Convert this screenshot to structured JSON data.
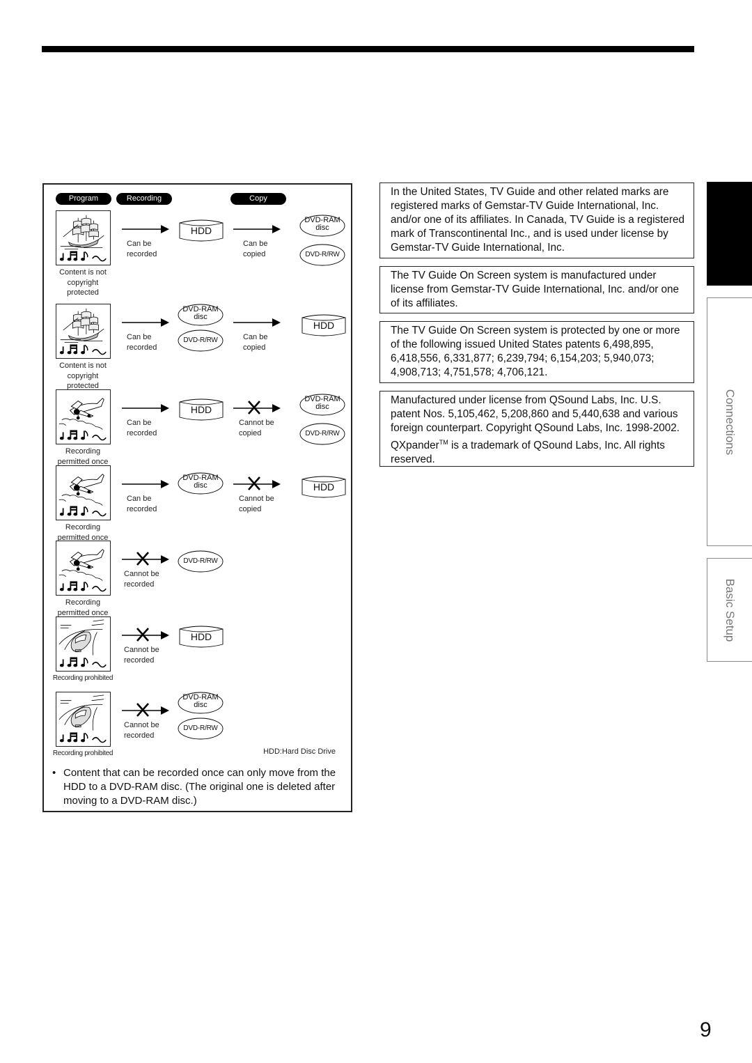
{
  "headers": {
    "program": "Program",
    "recording": "Recording",
    "copy": "Copy"
  },
  "labels": {
    "hdd": "HDD",
    "dvd_ram_line1": "DVD-RAM",
    "dvd_ram_line2": "disc",
    "dvd_rrw": "DVD-R/RW"
  },
  "rows": [
    {
      "picture": "sailing-ship",
      "caption": [
        "Content is not",
        "copyright",
        "protected"
      ],
      "record": {
        "allowed": true,
        "label": [
          "Can be",
          "recorded"
        ],
        "target": [
          "hdd"
        ]
      },
      "copy": {
        "allowed": true,
        "label": [
          "Can be",
          "copied"
        ],
        "target": [
          "dvd-ram",
          "dvd-rrw"
        ]
      }
    },
    {
      "picture": "sailing-ship",
      "caption": [
        "Content is not",
        "copyright",
        "protected"
      ],
      "record": {
        "allowed": true,
        "label": [
          "Can be",
          "recorded"
        ],
        "target": [
          "dvd-ram",
          "dvd-rrw"
        ]
      },
      "copy": {
        "allowed": true,
        "label": [
          "Can be",
          "copied"
        ],
        "target": [
          "hdd"
        ]
      }
    },
    {
      "picture": "airplane",
      "caption": [
        "Recording",
        "permitted once"
      ],
      "record": {
        "allowed": true,
        "label": [
          "Can be",
          "recorded"
        ],
        "target": [
          "hdd"
        ]
      },
      "copy": {
        "allowed": false,
        "label": [
          "Cannot be",
          "copied"
        ],
        "target": [
          "dvd-ram",
          "dvd-rrw"
        ]
      }
    },
    {
      "picture": "airplane",
      "caption": [
        "Recording",
        "permitted once"
      ],
      "record": {
        "allowed": true,
        "label": [
          "Can be",
          "recorded"
        ],
        "target": [
          "dvd-ram"
        ]
      },
      "copy": {
        "allowed": false,
        "label": [
          "Cannot be",
          "copied"
        ],
        "target": [
          "hdd"
        ]
      }
    },
    {
      "picture": "airplane",
      "caption": [
        "Recording",
        "permitted once"
      ],
      "record": {
        "allowed": false,
        "label": [
          "Cannot be",
          "recorded"
        ],
        "target": [
          "dvd-rrw"
        ]
      }
    },
    {
      "picture": "car",
      "caption": [
        "Recording prohibited"
      ],
      "record": {
        "allowed": false,
        "label": [
          "Cannot be",
          "recorded"
        ],
        "target": [
          "hdd"
        ]
      }
    },
    {
      "picture": "car",
      "caption": [
        "Recording prohibited"
      ],
      "record": {
        "allowed": false,
        "label": [
          "Cannot be",
          "recorded"
        ],
        "target": [
          "dvd-ram",
          "dvd-rrw"
        ]
      }
    }
  ],
  "legend_note": "HDD:Hard Disc Drive",
  "bullet": {
    "mark": "•",
    "text": "Content that can be recorded once can only move from the HDD to a DVD-RAM disc. (The original one is deleted after moving to a DVD-RAM disc.)"
  },
  "notices": [
    {
      "text": "In the United States, TV Guide and other related marks are registered marks of Gemstar-TV Guide International, Inc. and/or one of its affiliates. In Canada, TV Guide is a registered mark of Transcontinental Inc., and is used under license by Gemstar-TV Guide International, Inc."
    },
    {
      "text": "The TV Guide On Screen system is manufactured under license from Gemstar-TV Guide International, Inc. and/or one of its affiliates."
    },
    {
      "text": "The TV Guide On Screen system is protected by one or more of the following issued United States patents 6,498,895, 6,418,556, 6,331,877; 6,239,794; 6,154,203; 5,940,073; 4,908,713; 4,751,578; 4,706,121."
    },
    {
      "text_before": "Manufactured under license from QSound Labs, Inc. U.S. patent Nos. 5,105,462, 5,208,860 and 5,440,638 and various foreign counterpart. Copyright QSound Labs, Inc. 1998-2002. QXpander",
      "sup": "TM",
      "text_after": " is a trademark of QSound Labs, Inc. All rights reserved."
    }
  ],
  "side_tabs": {
    "active": "",
    "connections": "Connections",
    "basic_setup": "Basic Setup"
  },
  "page_number": "9"
}
